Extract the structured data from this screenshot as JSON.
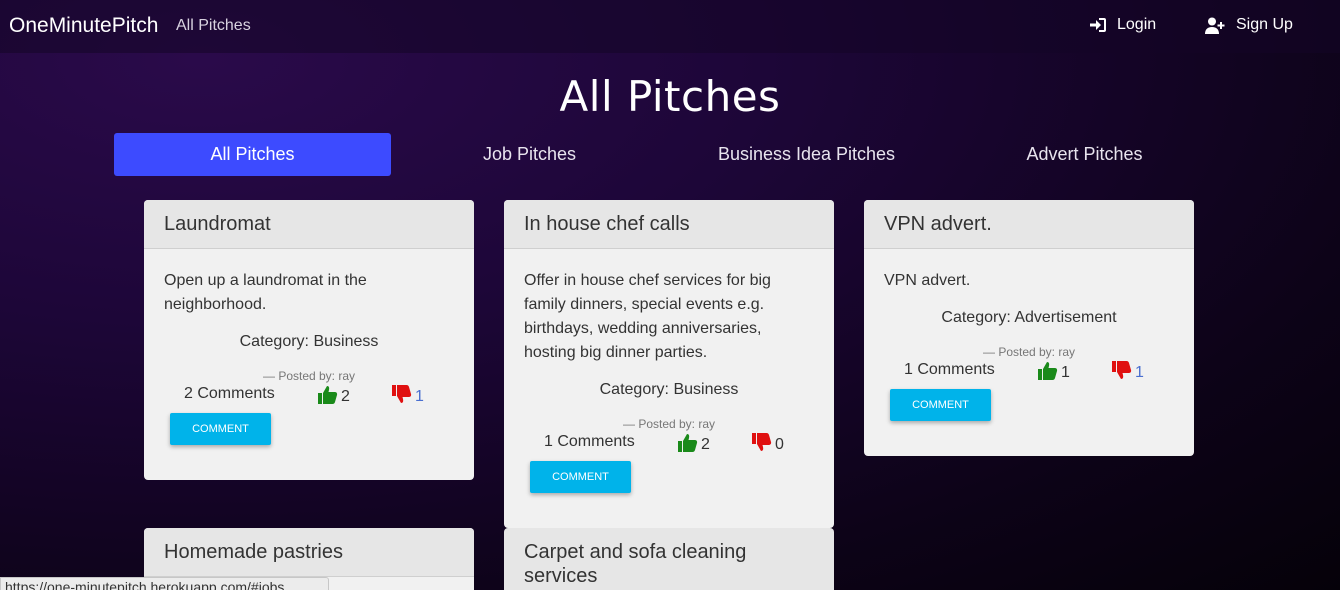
{
  "nav": {
    "brand": "OneMinutePitch",
    "all_pitches": "All Pitches",
    "login": "Login",
    "signup": "Sign Up"
  },
  "page_title": "All Pitches",
  "tabs": [
    {
      "label": "All Pitches",
      "active": true
    },
    {
      "label": "Job Pitches",
      "active": false
    },
    {
      "label": "Business Idea Pitches",
      "active": false
    },
    {
      "label": "Advert Pitches",
      "active": false
    }
  ],
  "cards": [
    {
      "title": "Laundromat",
      "description": "Open up a laundromat in the neighborhood.",
      "category": "Category: Business",
      "posted_by": "Posted by: ray",
      "comments": "2 Comments",
      "upvotes": "2",
      "downvotes": "1",
      "button": "COMMENT"
    },
    {
      "title": "In house chef calls",
      "description": "Offer in house chef services for big family dinners, special events e.g. birthdays, wedding anniversaries, hosting big dinner parties.",
      "category": "Category: Business",
      "posted_by": "Posted by: ray",
      "comments": "1 Comments",
      "upvotes": "2",
      "downvotes": "0",
      "button": "COMMENT"
    },
    {
      "title": "VPN advert.",
      "description": "VPN advert.",
      "category": "Category: Advertisement",
      "posted_by": "Posted by: ray",
      "comments": "1 Comments",
      "upvotes": "1",
      "downvotes": "1",
      "button": "COMMENT"
    },
    {
      "title": "Homemade pastries"
    },
    {
      "title": "Carpet and sofa cleaning services"
    }
  ],
  "status_url": "https://one-minutepitch.herokuapp.com/#jobs",
  "colors": {
    "active_tab": "#3d4bff",
    "comment_button": "#00b3ea",
    "thumbs_up": "#1a8a1a",
    "thumbs_down": "#e01010"
  }
}
